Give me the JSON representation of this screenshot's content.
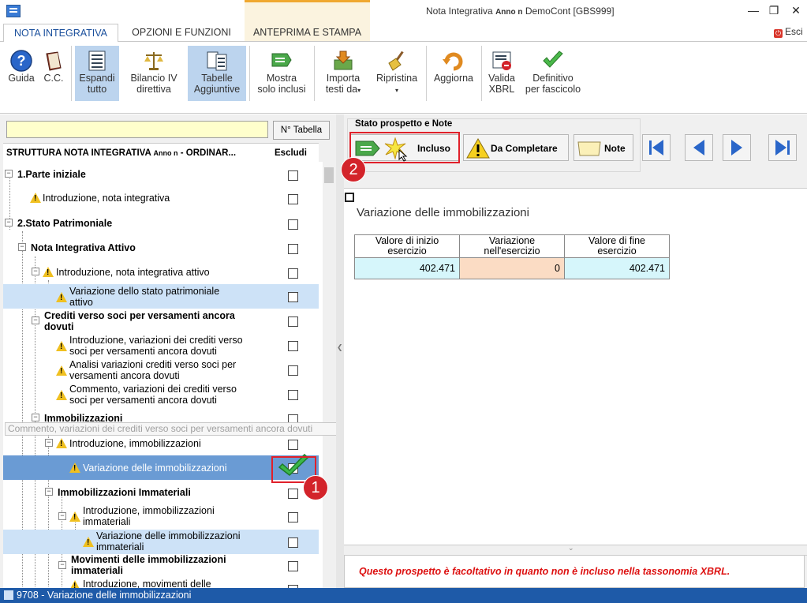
{
  "window": {
    "title_prefix": "Nota Integrativa",
    "title_year": "Anno n",
    "title_suffix": "DemoCont [GBS999]",
    "exit_label": "Esci"
  },
  "tabs": [
    "NOTA INTEGRATIVA",
    "OPZIONI E FUNZIONI",
    "ANTEPRIMA E STAMPA"
  ],
  "ribbon": {
    "guida": "Guida",
    "cc": "C.C.",
    "espandi_1": "Espandi",
    "espandi_2": "tutto",
    "bilancio_1": "Bilancio IV",
    "bilancio_2": "direttiva",
    "tabelle_1": "Tabelle",
    "tabelle_2": "Aggiuntive",
    "mostra_1": "Mostra",
    "mostra_2": "solo inclusi",
    "importa_1": "Importa",
    "importa_2": "testi da",
    "ripristina": "Ripristina",
    "aggiorna": "Aggiorna",
    "valida_1": "Valida",
    "valida_2": "XBRL",
    "definitivo_1": "Definitivo",
    "definitivo_2": "per fascicolo",
    "dropdown_glyph": "▾"
  },
  "left": {
    "search_value": "",
    "ntab_label": "N° Tabella",
    "header_prefix": "STRUTTURA NOTA INTEGRATIVA",
    "header_year": "Anno n",
    "header_suffix": "- ORDINAR...",
    "header_escludi": "Escludi",
    "tooltip": "Commento, variazioni dei crediti verso soci per versamenti ancora dovuti",
    "rows": [
      {
        "l1": "1.Parte iniziale"
      },
      {
        "l1": "Introduzione, nota integrativa"
      },
      {
        "l1": "2.Stato Patrimoniale"
      },
      {
        "l1": "Nota Integrativa Attivo"
      },
      {
        "l1": "Introduzione, nota integrativa attivo"
      },
      {
        "l1": "Variazione dello stato patrimoniale",
        "l2": "attivo"
      },
      {
        "l1": "Crediti verso soci per versamenti ancora",
        "l2": "dovuti"
      },
      {
        "l1": "Introduzione, variazioni dei crediti verso",
        "l2": "soci per versamenti ancora dovuti"
      },
      {
        "l1": "Analisi variazioni crediti verso soci per",
        "l2": "versamenti ancora dovuti"
      },
      {
        "l1": "Commento, variazioni dei crediti verso",
        "l2": "soci per versamenti ancora dovuti"
      },
      {
        "l1": "Immobilizzazioni"
      },
      {
        "l1": "Introduzione, immobilizzazioni"
      },
      {
        "l1": "Variazione delle immobilizzazioni"
      },
      {
        "l1": "Immobilizzazioni Immateriali"
      },
      {
        "l1": "Introduzione, immobilizzazioni",
        "l2": "immateriali"
      },
      {
        "l1": "Variazione delle immobilizzazioni",
        "l2": "immateriali"
      },
      {
        "l1": "Movimenti delle immobilizzazioni",
        "l2": "immateriali"
      },
      {
        "l1": "Introduzione, movimenti delle"
      }
    ]
  },
  "right": {
    "group_title": "Stato prospetto e Note",
    "incluso": "Incluso",
    "da_completare": "Da Completare",
    "note": "Note",
    "section_title": "Variazione delle immobilizzazioni",
    "table": {
      "headers": [
        {
          "l1": "Valore di inizio",
          "l2": "esercizio"
        },
        {
          "l1": "Variazione",
          "l2": "nell'esercizio"
        },
        {
          "l1": "Valore di fine",
          "l2": "esercizio"
        }
      ],
      "values": [
        "402.471",
        "0",
        "402.471"
      ]
    },
    "note_text": "Questo prospetto è facoltativo in quanto non è incluso nella tassonomia XBRL."
  },
  "badges": {
    "one": "1",
    "two": "2"
  },
  "status": {
    "text": "9708 - Variazione delle immobilizzazioni"
  },
  "colors": {
    "accent_tab": "#1a4f9c",
    "selected_row": "#6a9bd4",
    "highlight_row": "#cde2f7",
    "cyan_cell": "#d6f6fb",
    "peach_cell": "#fbdcc4",
    "note_red": "#dd1111",
    "status_bar": "#1e5aa8",
    "callout_red": "#d3232a"
  }
}
